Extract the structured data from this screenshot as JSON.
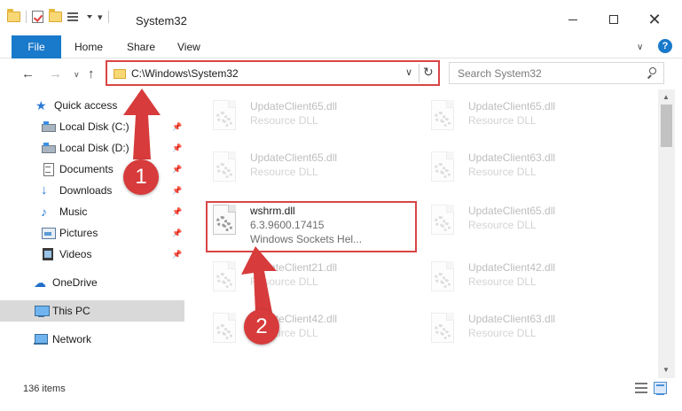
{
  "window": {
    "title": "System32",
    "minimize_icon": "minimize-icon",
    "maximize_icon": "maximize-icon",
    "close_icon": "close-icon",
    "close_glyph": "✕"
  },
  "ribbon": {
    "tabs": [
      {
        "label": "File",
        "active": true
      },
      {
        "label": "Home"
      },
      {
        "label": "Share"
      },
      {
        "label": "View"
      }
    ],
    "expand_glyph": "∨",
    "help_glyph": "?",
    "accent": "#1979ca"
  },
  "address": {
    "path": "C:\\Windows\\System32",
    "dropdown_glyph": "∨",
    "refresh_glyph": "↻"
  },
  "nav": {
    "back_glyph": "←",
    "forward_glyph": "→",
    "recent_glyph": "∨",
    "up_glyph": "↑"
  },
  "search": {
    "placeholder": "Search System32"
  },
  "sidebar": {
    "items": [
      {
        "label": "Quick access",
        "icon": "star-icon",
        "glyph": "★",
        "pinned": false
      },
      {
        "label": "Local Disk (C:)",
        "icon": "drive-icon",
        "pinned": true
      },
      {
        "label": "Local Disk (D:)",
        "icon": "drive-icon",
        "pinned": true
      },
      {
        "label": "Documents",
        "icon": "document-icon",
        "pinned": true
      },
      {
        "label": "Downloads",
        "icon": "download-icon",
        "glyph": "🡇",
        "pinned": true
      },
      {
        "label": "Music",
        "icon": "music-icon",
        "glyph": "♪",
        "pinned": true
      },
      {
        "label": "Pictures",
        "icon": "pictures-icon",
        "pinned": true
      },
      {
        "label": "Videos",
        "icon": "video-icon",
        "pinned": true
      },
      {
        "label": "OneDrive",
        "icon": "cloud-icon",
        "glyph": "☁",
        "pinned": false
      },
      {
        "label": "This PC",
        "icon": "computer-icon",
        "pinned": false,
        "selected": true
      },
      {
        "label": "Network",
        "icon": "network-icon",
        "pinned": false
      }
    ],
    "pin_glyph": "📌"
  },
  "files": {
    "left_column": [
      {
        "name": "UpdateClient65.dll",
        "desc": "Resource DLL"
      },
      {
        "name": "UpdateClient65.dll",
        "desc": "Resource DLL"
      },
      {
        "name": "wshrm.dll",
        "version": "6.3.9600.17415",
        "desc": "Windows Sockets Hel...",
        "highlighted": true
      },
      {
        "name": "UpdateClient21.dll",
        "desc": "Resource DLL"
      },
      {
        "name": "UpdateClient42.dll",
        "desc": "Resource DLL"
      }
    ],
    "right_column": [
      {
        "name": "UpdateClient65.dll",
        "desc": "Resource DLL"
      },
      {
        "name": "UpdateClient63.dll",
        "desc": "Resource DLL"
      },
      {
        "name": "UpdateClient65.dll",
        "desc": "Resource DLL"
      },
      {
        "name": "UpdateClient42.dll",
        "desc": "Resource DLL"
      },
      {
        "name": "UpdateClient63.dll",
        "desc": "Resource DLL"
      }
    ]
  },
  "status": {
    "item_count": "136 items"
  },
  "annotations": {
    "step1": "1",
    "step2": "2",
    "color": "#d94545"
  }
}
